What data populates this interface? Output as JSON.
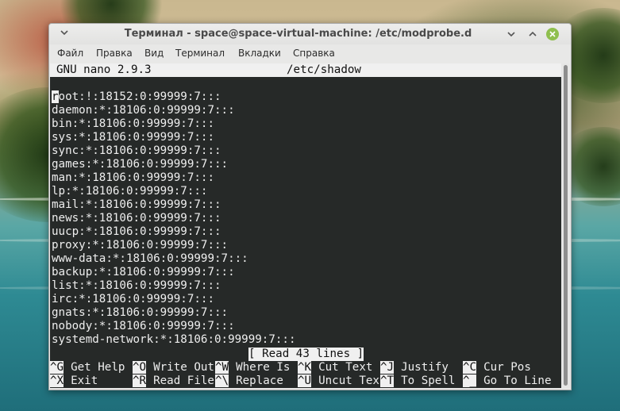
{
  "window": {
    "title": "Терминал - space@space-virtual-machine: /etc/modprobe.d",
    "menu": [
      "Файл",
      "Правка",
      "Вид",
      "Терминал",
      "Вкладки",
      "Справка"
    ],
    "controls": {
      "menu_icon": "chevron-down-icon",
      "minimize_icon": "minimize-icon",
      "maximize_icon": "maximize-icon",
      "close_icon": "close-icon"
    }
  },
  "nano": {
    "version": "GNU nano 2.9.3",
    "filename": "/etc/shadow",
    "cursor_char": "r",
    "lines": [
      "root:!:18152:0:99999:7:::",
      "daemon:*:18106:0:99999:7:::",
      "bin:*:18106:0:99999:7:::",
      "sys:*:18106:0:99999:7:::",
      "sync:*:18106:0:99999:7:::",
      "games:*:18106:0:99999:7:::",
      "man:*:18106:0:99999:7:::",
      "lp:*:18106:0:99999:7:::",
      "mail:*:18106:0:99999:7:::",
      "news:*:18106:0:99999:7:::",
      "uucp:*:18106:0:99999:7:::",
      "proxy:*:18106:0:99999:7:::",
      "www-data:*:18106:0:99999:7:::",
      "backup:*:18106:0:99999:7:::",
      "list:*:18106:0:99999:7:::",
      "irc:*:18106:0:99999:7:::",
      "gnats:*:18106:0:99999:7:::",
      "nobody:*:18106:0:99999:7:::",
      "systemd-network:*:18106:0:99999:7:::"
    ],
    "status": "[ Read 43 lines ]",
    "shortcuts": [
      [
        {
          "key": "^G",
          "label": "Get Help"
        },
        {
          "key": "^O",
          "label": "Write Out"
        },
        {
          "key": "^W",
          "label": "Where Is"
        },
        {
          "key": "^K",
          "label": "Cut Text"
        },
        {
          "key": "^J",
          "label": "Justify"
        },
        {
          "key": "^C",
          "label": "Cur Pos"
        }
      ],
      [
        {
          "key": "^X",
          "label": "Exit"
        },
        {
          "key": "^R",
          "label": "Read File"
        },
        {
          "key": "^\\",
          "label": "Replace"
        },
        {
          "key": "^U",
          "label": "Uncut Text"
        },
        {
          "key": "^T",
          "label": "To Spell"
        },
        {
          "key": "^_",
          "label": "Go To Line"
        }
      ]
    ]
  }
}
